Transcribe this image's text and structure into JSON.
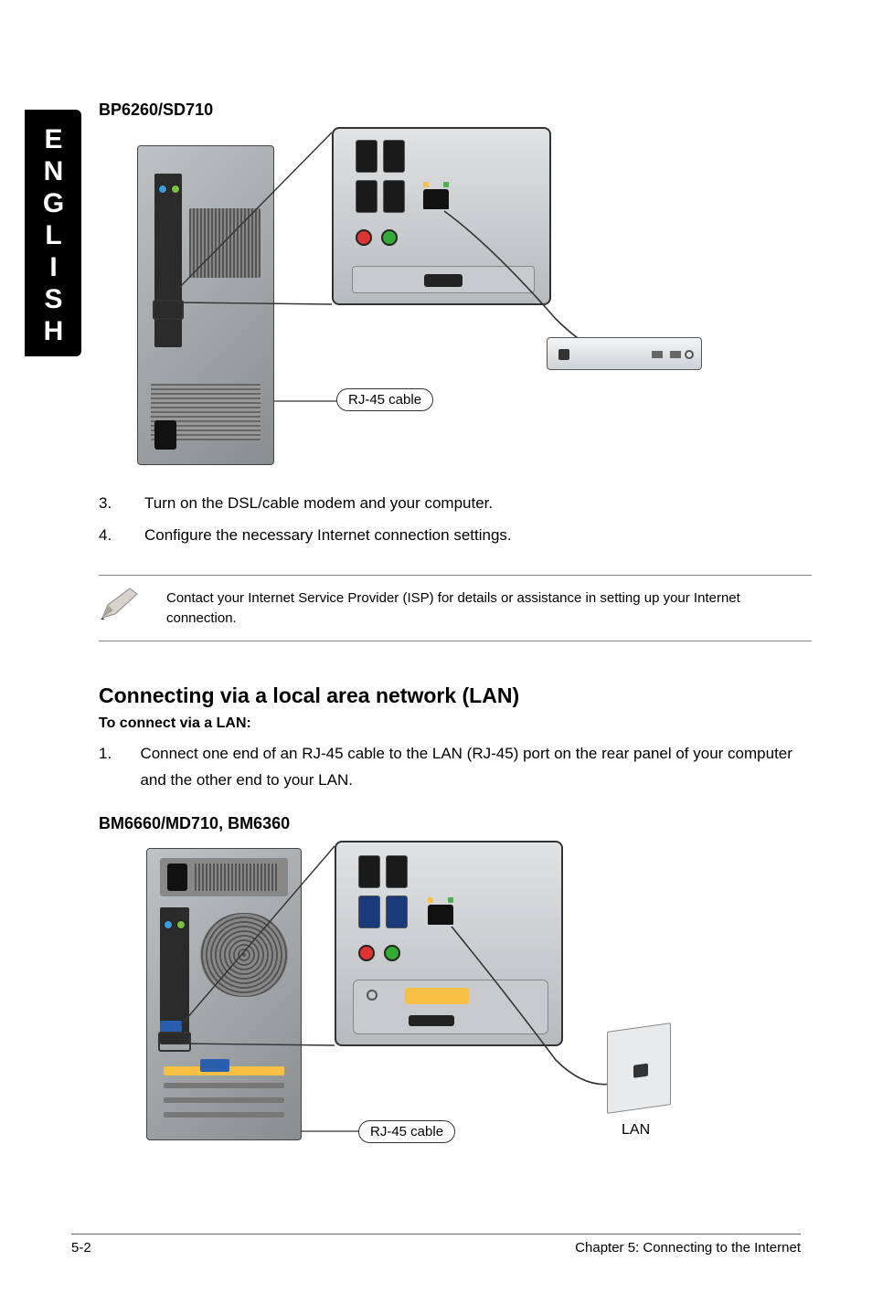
{
  "sideTab": "ENGLISH",
  "model1": "BP6260/SD710",
  "diagram1": {
    "callout": "RJ-45 cable"
  },
  "steps1": [
    {
      "num": "3.",
      "text": "Turn on the DSL/cable modem and your computer."
    },
    {
      "num": "4.",
      "text": "Configure the necessary Internet connection settings."
    }
  ],
  "note": "Contact your Internet Service Provider (ISP) for details or assistance in setting up your Internet connection.",
  "lanHeading": "Connecting via a local area network (LAN)",
  "lanSub": "To connect via a LAN:",
  "steps2": [
    {
      "num": "1.",
      "text": "Connect one end of an RJ-45 cable to the LAN (RJ-45) port on the rear panel of your computer and the other end to your LAN."
    }
  ],
  "model2": "BM6660/MD710, BM6360",
  "diagram2": {
    "callout": "RJ-45 cable",
    "lanLabel": "LAN"
  },
  "footer": {
    "pageNum": "5-2",
    "chapter": "Chapter 5: Connecting to the Internet"
  }
}
